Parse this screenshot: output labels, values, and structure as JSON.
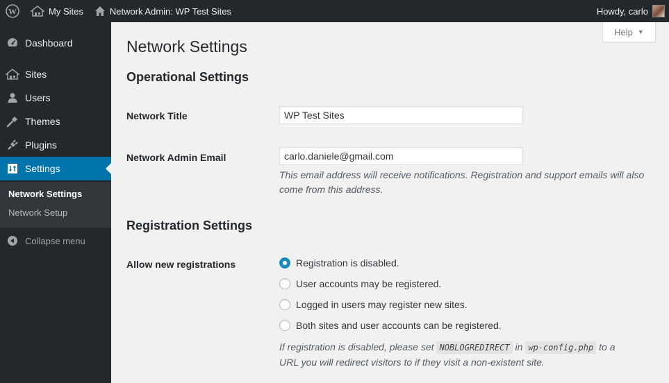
{
  "adminbar": {
    "my_sites": "My Sites",
    "network_admin": "Network Admin: WP Test Sites",
    "howdy": "Howdy, carlo"
  },
  "sidebar": {
    "items": [
      {
        "label": "Dashboard",
        "icon": "dashboard-icon"
      },
      {
        "label": "Sites",
        "icon": "sites-icon"
      },
      {
        "label": "Users",
        "icon": "users-icon"
      },
      {
        "label": "Themes",
        "icon": "themes-icon"
      },
      {
        "label": "Plugins",
        "icon": "plugins-icon"
      },
      {
        "label": "Settings",
        "icon": "settings-icon"
      }
    ],
    "submenu": [
      "Network Settings",
      "Network Setup"
    ],
    "collapse": "Collapse menu"
  },
  "help": {
    "label": "Help"
  },
  "page": {
    "title": "Network Settings",
    "operational_title": "Operational Settings",
    "network_title_label": "Network Title",
    "network_title_value": "WP Test Sites",
    "admin_email_label": "Network Admin Email",
    "admin_email_value": "carlo.daniele@gmail.com",
    "admin_email_desc": "This email address will receive notifications. Registration and support emails will also come from this address.",
    "registration_title": "Registration Settings",
    "allow_label": "Allow new registrations",
    "radio_options": [
      "Registration is disabled.",
      "User accounts may be registered.",
      "Logged in users may register new sites.",
      "Both sites and user accounts can be registered."
    ],
    "selected_option": "Registration is disabled.",
    "reg_note_1": "If registration is disabled, please set",
    "reg_note_code1": "NOBLOGREDIRECT",
    "reg_note_in": "in",
    "reg_note_code2": "wp-config.php",
    "reg_note_2": "to a",
    "reg_note_3": "URL you will redirect visitors to if they visit a non-existent site."
  },
  "colors": {
    "adminbar_bg": "#23282d",
    "accent": "#0073aa",
    "content_bg": "#f1f1f1"
  }
}
